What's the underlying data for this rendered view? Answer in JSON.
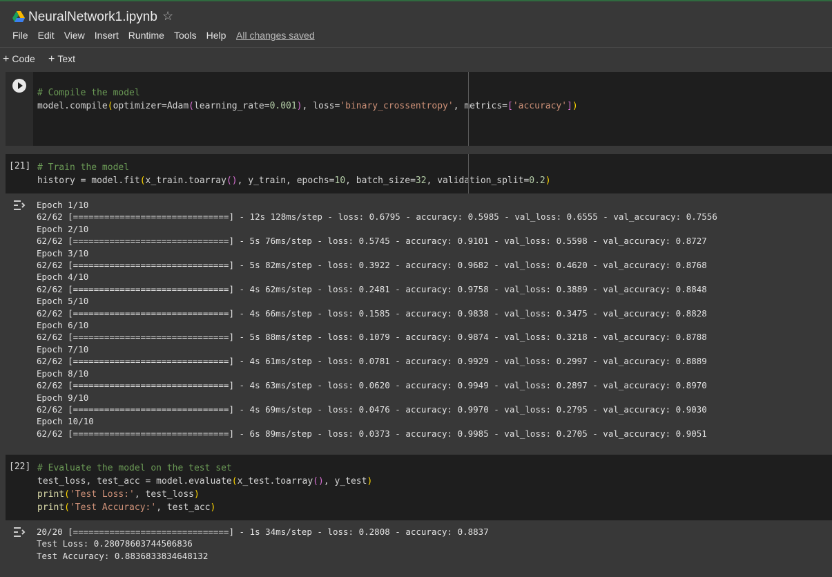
{
  "header": {
    "title": "NeuralNetwork1.ipynb",
    "menu": [
      "File",
      "Edit",
      "View",
      "Insert",
      "Runtime",
      "Tools",
      "Help"
    ],
    "status": "All changes saved"
  },
  "toolbar": {
    "code_label": "Code",
    "text_label": "Text"
  },
  "cells": {
    "compile": {
      "exec_count": "",
      "comment": "# Compile the model",
      "code_line": "model.compile(optimizer=Adam(learning_rate=0.001), loss='binary_crossentropy', metrics=['accuracy'])"
    },
    "train": {
      "exec_count": "[21]",
      "comment": "# Train the model",
      "code_line": "history = model.fit(x_train.toarray(), y_train, epochs=10, batch_size=32, validation_split=0.2)",
      "output": [
        "Epoch 1/10",
        "62/62 [==============================] - 12s 128ms/step - loss: 0.6795 - accuracy: 0.5985 - val_loss: 0.6555 - val_accuracy: 0.7556",
        "Epoch 2/10",
        "62/62 [==============================] - 5s 76ms/step - loss: 0.5745 - accuracy: 0.9101 - val_loss: 0.5598 - val_accuracy: 0.8727",
        "Epoch 3/10",
        "62/62 [==============================] - 5s 82ms/step - loss: 0.3922 - accuracy: 0.9682 - val_loss: 0.4620 - val_accuracy: 0.8768",
        "Epoch 4/10",
        "62/62 [==============================] - 4s 62ms/step - loss: 0.2481 - accuracy: 0.9758 - val_loss: 0.3889 - val_accuracy: 0.8848",
        "Epoch 5/10",
        "62/62 [==============================] - 4s 66ms/step - loss: 0.1585 - accuracy: 0.9838 - val_loss: 0.3475 - val_accuracy: 0.8828",
        "Epoch 6/10",
        "62/62 [==============================] - 5s 88ms/step - loss: 0.1079 - accuracy: 0.9874 - val_loss: 0.3218 - val_accuracy: 0.8788",
        "Epoch 7/10",
        "62/62 [==============================] - 4s 61ms/step - loss: 0.0781 - accuracy: 0.9929 - val_loss: 0.2997 - val_accuracy: 0.8889",
        "Epoch 8/10",
        "62/62 [==============================] - 4s 63ms/step - loss: 0.0620 - accuracy: 0.9949 - val_loss: 0.2897 - val_accuracy: 0.8970",
        "Epoch 9/10",
        "62/62 [==============================] - 4s 69ms/step - loss: 0.0476 - accuracy: 0.9970 - val_loss: 0.2795 - val_accuracy: 0.9030",
        "Epoch 10/10",
        "62/62 [==============================] - 6s 89ms/step - loss: 0.0373 - accuracy: 0.9985 - val_loss: 0.2705 - val_accuracy: 0.9051"
      ]
    },
    "evaluate": {
      "exec_count": "[22]",
      "comment": "# Evaluate the model on the test set",
      "code_lines": [
        "test_loss, test_acc = model.evaluate(x_test.toarray(), y_test)",
        "print('Test Loss:', test_loss)",
        "print('Test Accuracy:', test_acc)"
      ],
      "output": [
        "20/20 [==============================] - 1s 34ms/step - loss: 0.2808 - accuracy: 0.8837",
        "Test Loss: 0.28078603744506836",
        "Test Accuracy: 0.8836833834648132"
      ]
    }
  },
  "icons": {
    "logo": "drive-logo-icon",
    "star": "star-icon",
    "run": "play-icon",
    "output": "output-toggle-icon"
  },
  "colors": {
    "background": "#383838",
    "code_bg": "#1e1e1e",
    "comment": "#6a9955",
    "string": "#ce9178",
    "number": "#b5cea8"
  }
}
